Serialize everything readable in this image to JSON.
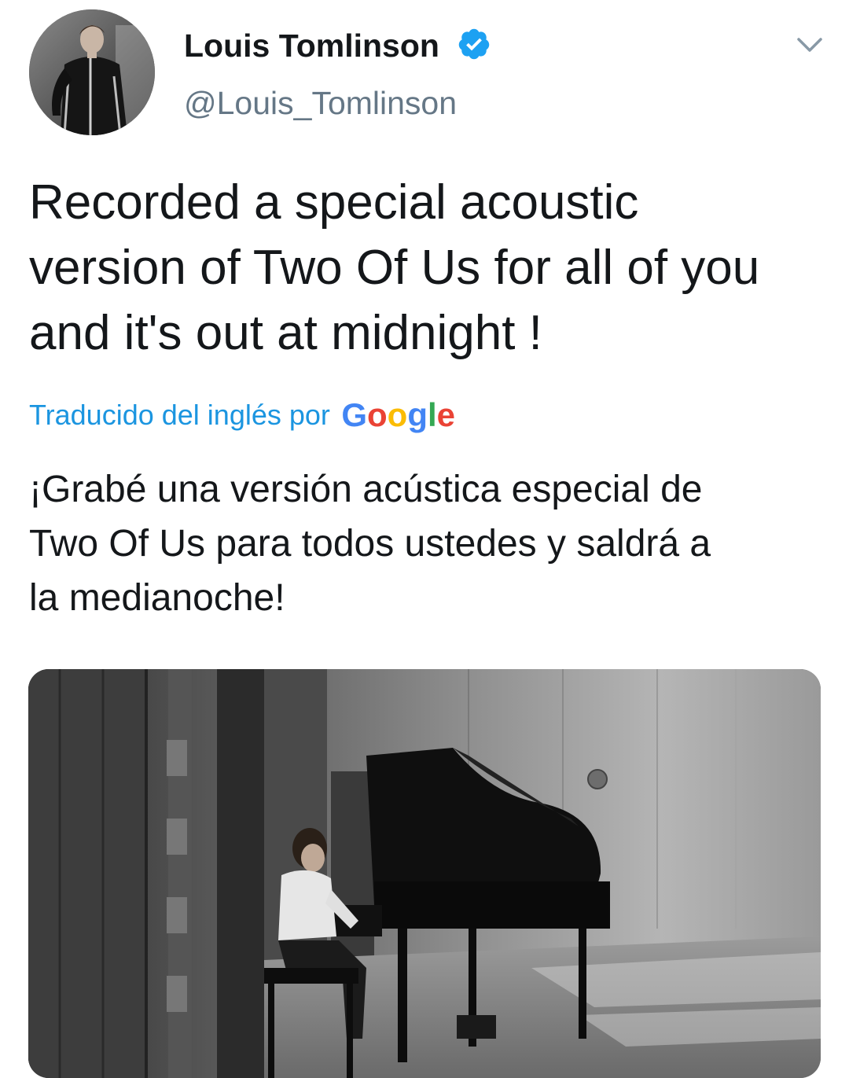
{
  "tweet": {
    "author": {
      "display_name": "Louis Tomlinson",
      "handle": "@Louis_Tomlinson",
      "verified": true
    },
    "text_lines": [
      "Recorded a special acoustic",
      "version of Two Of Us for all of you",
      "and it's out at midnight !"
    ],
    "translation": {
      "label": "Traducido del inglés por",
      "provider": "Google",
      "text_lines": [
        "¡Grabé una versión acústica especial de",
        "Two Of Us para todos ustedes y saldrá a",
        "la medianoche!"
      ]
    },
    "media": {
      "type": "photo"
    }
  },
  "icons": {
    "verified": "verified-badge-icon",
    "menu": "chevron-down-icon"
  },
  "colors": {
    "text_primary": "#14171a",
    "text_secondary": "#657786",
    "link_blue": "#1b95e0",
    "verified_blue": "#1da1f2",
    "google_blue": "#4285f4",
    "google_red": "#ea4335",
    "google_yellow": "#fbbc05",
    "google_green": "#34a853"
  }
}
